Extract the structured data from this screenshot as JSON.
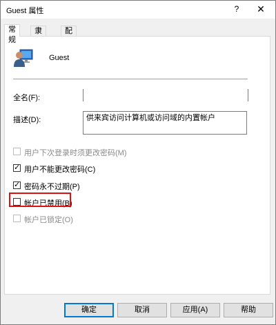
{
  "window": {
    "title": "Guest 属性",
    "help_label": "?",
    "close_label": "✕"
  },
  "tabs": [
    {
      "label": "常规",
      "active": true
    },
    {
      "label": "隶属于",
      "active": false
    },
    {
      "label": "配置文件",
      "active": false
    }
  ],
  "user": {
    "name": "Guest",
    "icon": "user-account-icon"
  },
  "fields": {
    "fullname_label": "全名(F):",
    "fullname_value": "",
    "description_label": "描述(D):",
    "description_value": "供来宾访问计算机或访问域的内置帐户"
  },
  "checkboxes": [
    {
      "label": "用户下次登录时须更改密码(M)",
      "checked": false,
      "disabled": true
    },
    {
      "label": "用户不能更改密码(C)",
      "checked": true,
      "disabled": false
    },
    {
      "label": "密码永不过期(P)",
      "checked": true,
      "disabled": false
    },
    {
      "label": "帐户已禁用(B)",
      "checked": false,
      "disabled": false
    },
    {
      "label": "帐户已锁定(O)",
      "checked": false,
      "disabled": true
    }
  ],
  "buttons": {
    "ok": "确定",
    "cancel": "取消",
    "apply": "应用(A)",
    "help": "帮助"
  },
  "colors": {
    "highlight": "#e01010",
    "default_button_border": "#0078d7"
  }
}
